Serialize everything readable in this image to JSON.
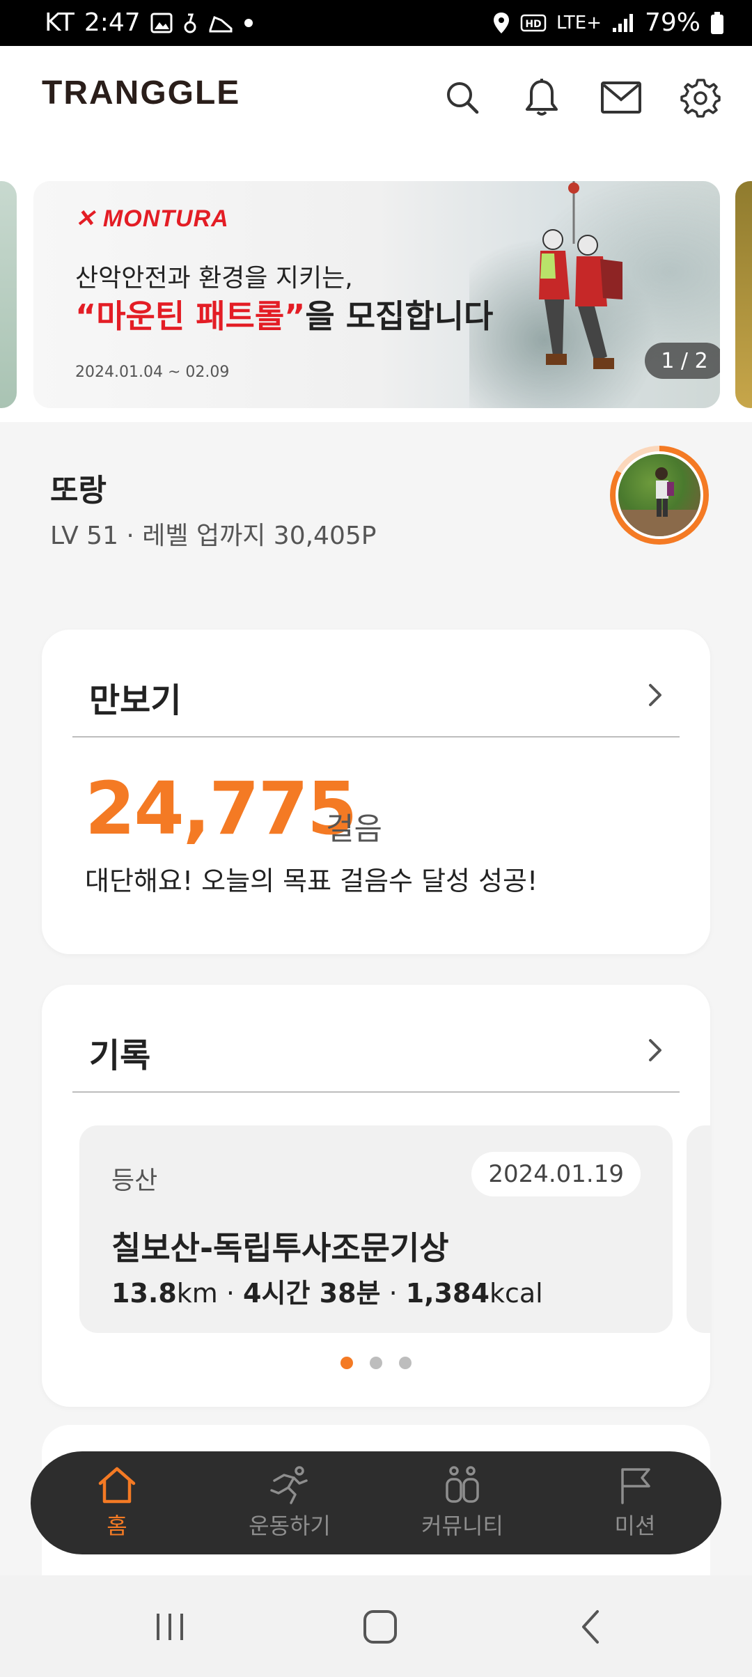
{
  "status": {
    "carrier": "KT",
    "time": "2:47",
    "network": "LTE+",
    "battery": "79%"
  },
  "header": {
    "logo": "TRANGGLE"
  },
  "banner": {
    "brand": "✕ MONTURA",
    "line1": "산악안전과 환경을 지키는,",
    "line2_highlight": "“마운틴 패트롤”",
    "line2_rest": "을 모집합니다",
    "dates": "2024.01.04 ~ 02.09",
    "page_indicator": "1 / 2"
  },
  "profile": {
    "name": "또랑",
    "level_text": "LV 51 · 레벨 업까지 30,405P"
  },
  "pedometer": {
    "title": "만보기",
    "steps": "24,775",
    "unit": "걸음",
    "message": "대단해요! 오늘의 목표 걸음수 달성 성공!"
  },
  "records": {
    "title": "기록",
    "item": {
      "type": "등산",
      "date": "2024.01.19",
      "name": "칠보산-독립투사조문기상",
      "distance": "13.8",
      "distance_unit": "km",
      "duration": "4시간 38분",
      "calories": "1,384",
      "calories_unit": "kcal"
    },
    "page_count": 3,
    "active_page": 1
  },
  "nav": {
    "home": "홈",
    "exercise": "운동하기",
    "community": "커뮤니티",
    "mission": "미션"
  },
  "colors": {
    "accent": "#f47a24",
    "banner_red": "#e31d25",
    "nav_bg": "#2d2d2d"
  }
}
